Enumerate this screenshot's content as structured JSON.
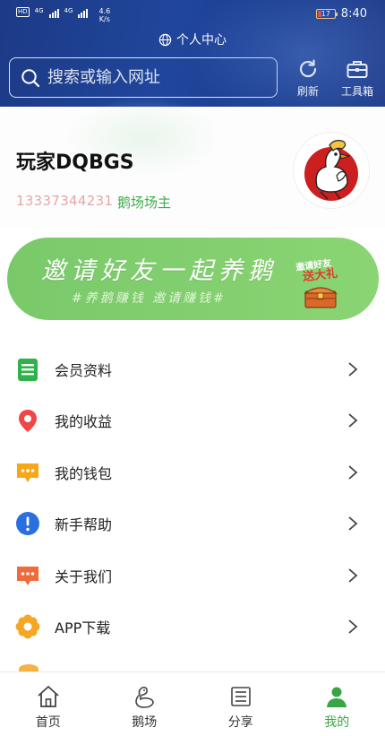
{
  "status_bar": {
    "hd_label": "HD",
    "net_label_1": "4G",
    "net_label_2": "4G",
    "speed_value": "4.6",
    "speed_unit": "K/s",
    "battery": "17",
    "time": "8:40"
  },
  "header": {
    "title": "个人中心",
    "search_placeholder": "搜索或输入网址",
    "refresh_label": "刷新",
    "toolbox_label": "工具箱"
  },
  "profile": {
    "username": "玩家DQBGS",
    "phone": "13337344231",
    "role": "鹅场场主"
  },
  "banner": {
    "title": "邀请好友一起养鹅",
    "subtitle": "#养鹅赚钱 邀请赚钱#",
    "gift_top": "邀请好友",
    "gift_main": "送大礼"
  },
  "menu": [
    {
      "label": "会员资料",
      "icon": "member-list-icon"
    },
    {
      "label": "我的收益",
      "icon": "location-pin-icon"
    },
    {
      "label": "我的钱包",
      "icon": "chat-bubble-icon"
    },
    {
      "label": "新手帮助",
      "icon": "exclamation-icon"
    },
    {
      "label": "关于我们",
      "icon": "message-icon"
    },
    {
      "label": "APP下载",
      "icon": "flower-icon"
    }
  ],
  "tabs": [
    {
      "label": "首页",
      "icon": "home-icon"
    },
    {
      "label": "鹅场",
      "icon": "goose-icon"
    },
    {
      "label": "分享",
      "icon": "share-icon"
    },
    {
      "label": "我的",
      "icon": "person-icon",
      "active": true
    }
  ],
  "colors": {
    "header_bg": "#1f4396",
    "accent_green": "#3aa545",
    "banner_green": "#7fcc6c",
    "phone_pink": "#e7a6a6"
  }
}
